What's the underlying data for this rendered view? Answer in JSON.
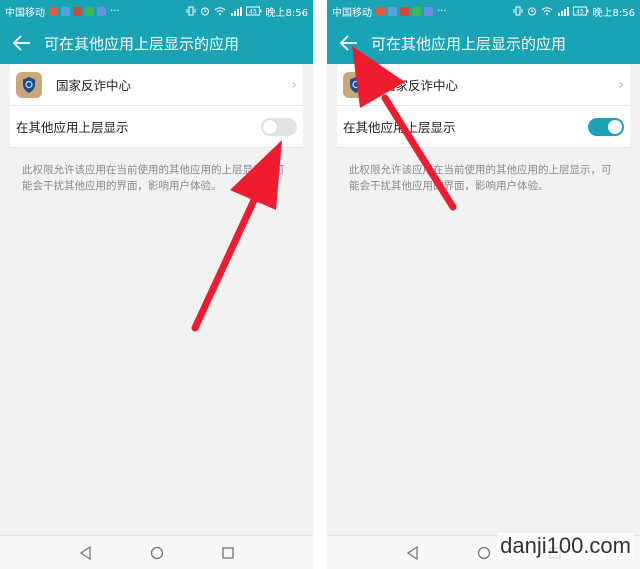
{
  "status_bar": {
    "carrier": "中国移动",
    "more": "···",
    "time": "晚上8:56",
    "battery": "45"
  },
  "app_bar": {
    "title": "可在其他应用上层显示的应用"
  },
  "app_row": {
    "name": "国家反诈中心",
    "chevron": "›"
  },
  "toggle_row": {
    "label": "在其他应用上层显示"
  },
  "description": "此权限允许该应用在当前使用的其他应用的上层显示，可能会干扰其他应用的界面，影响用户体验。",
  "screens": {
    "left": {
      "toggle_state": "off"
    },
    "right": {
      "toggle_state": "on"
    }
  },
  "colors": {
    "accent": "#1aa3b4",
    "arrow": "#ee1c2e",
    "toggle_off": "#e2e2e2"
  },
  "watermark": "danji100.com"
}
